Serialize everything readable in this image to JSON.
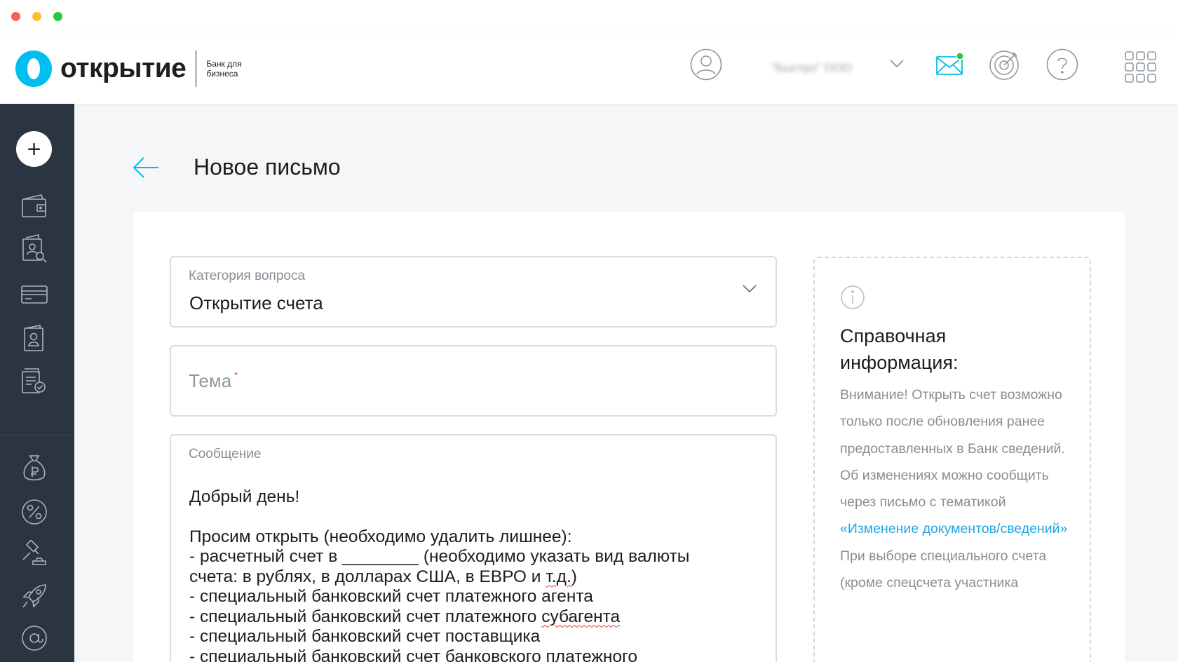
{
  "header": {
    "brand_name": "открытие",
    "brand_sub": "Банк для бизнеса",
    "company_name": "\"Быстро\" ООО"
  },
  "colors": {
    "accent": "#00bef0",
    "sidebar_bg": "#2a3541",
    "link": "#1fa6e0",
    "notification_dot": "#29c23f"
  },
  "header_icons": [
    "user-icon",
    "chevron-down-icon",
    "mail-icon",
    "target-icon",
    "help-icon",
    "apps-grid-icon"
  ],
  "sidebar": {
    "add_label": "+",
    "items": [
      {
        "name": "wallet-icon"
      },
      {
        "name": "contractor-search-icon"
      },
      {
        "name": "card-icon"
      },
      {
        "name": "id-card-icon"
      },
      {
        "name": "document-check-icon"
      },
      {
        "name": "money-bag-icon"
      },
      {
        "name": "percent-icon"
      },
      {
        "name": "auction-hammer-icon"
      },
      {
        "name": "rocket-icon"
      },
      {
        "name": "at-sign-icon"
      }
    ]
  },
  "page": {
    "title": "Новое письмо"
  },
  "form": {
    "category_label": "Категория вопроса",
    "category_value": "Открытие счета",
    "subject_placeholder": "Тема",
    "message_label": "Сообщение",
    "message": {
      "greeting": "Добрый день!",
      "line1": "Просим открыть (необходимо удалить лишнее):",
      "line2": "- расчетный счет в ________ (необходимо указать вид валюты",
      "line3a": "счета: в рублях, в долларах США, в ЕВРО и ",
      "line3b": "т.д.",
      "line3c": ")",
      "line4": "- специальный банковский счет платежного агента",
      "line5a": "- специальный банковский счет платежного ",
      "line5b": "субагента",
      "line6": "- специальный банковский счет поставщика",
      "line7": "- специальный банковский счет банковского платежного"
    }
  },
  "info": {
    "title": "Справочная информация:",
    "p1": "Внимание! Открыть счет возможно только после обновления ранее предоставленных в Банк сведений.",
    "p2": "Об изменениях можно сообщить через письмо с тематикой ",
    "p2_link": "«Изменение документов/сведений»",
    "p3": "При выборе специального счета (кроме спецсчета участника"
  }
}
